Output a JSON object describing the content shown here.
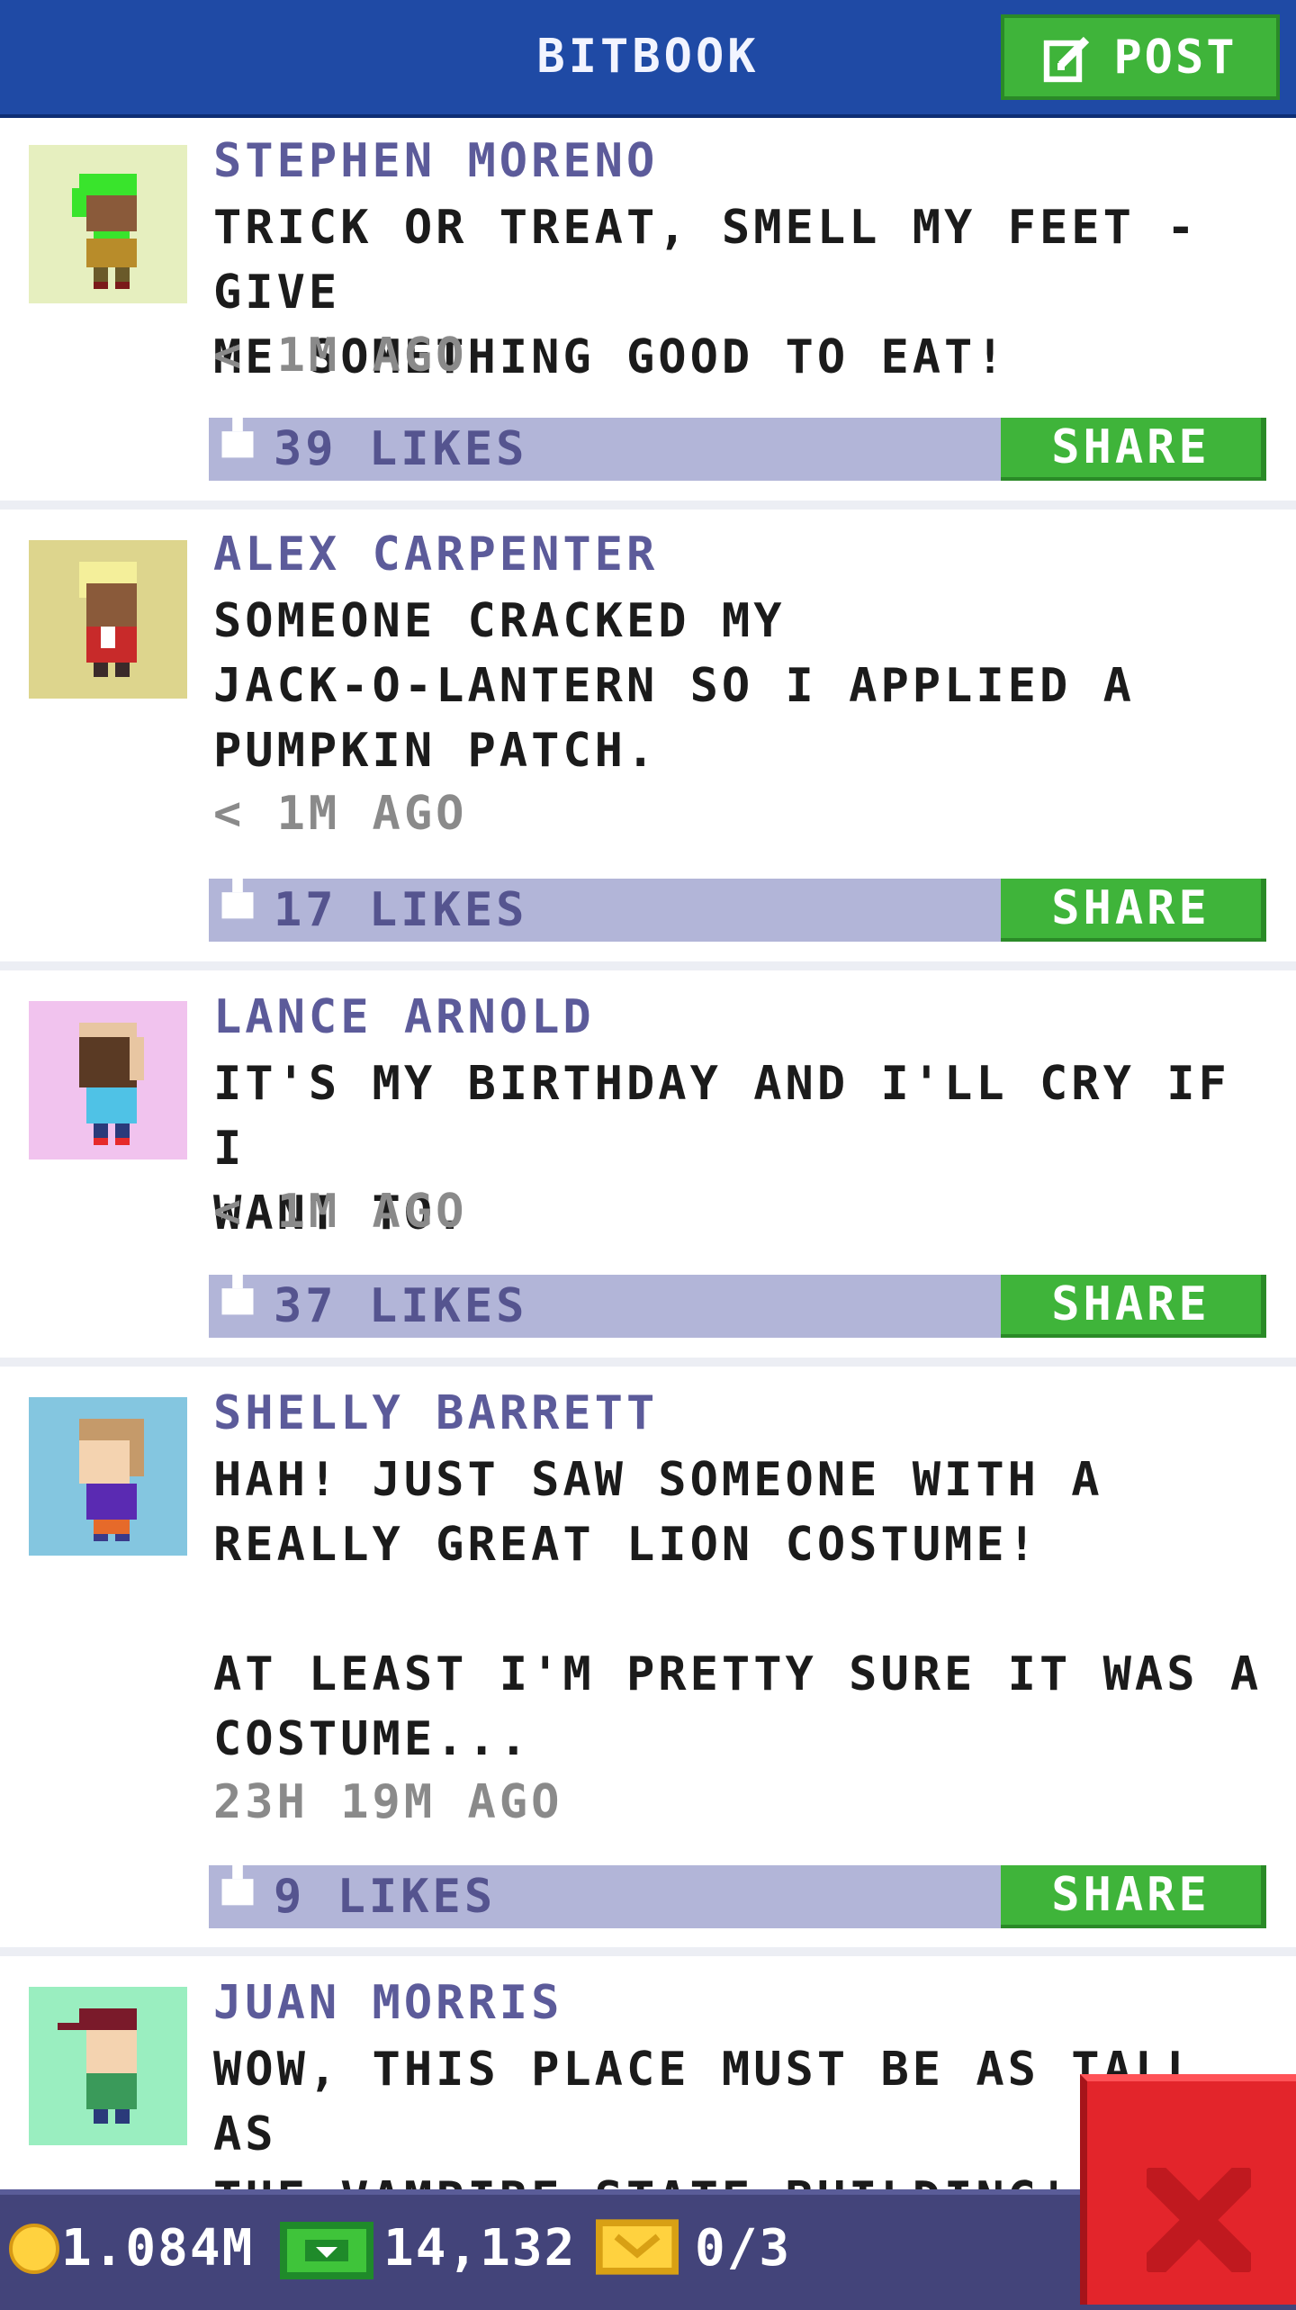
{
  "header": {
    "title": "BITBOOK",
    "post_label": "POST"
  },
  "posts": [
    {
      "author": "STEPHEN MORENO",
      "message": "TRICK OR TREAT, SMELL MY FEET - GIVE\nME SOMETHING GOOD TO EAT!",
      "time": "< 1M AGO",
      "likes": "39 LIKES",
      "share": "SHARE",
      "avatar_bg": "#e6efbf",
      "hair": "#39e42c",
      "skin": "#8a5a3a",
      "shirt": "#b88c2a",
      "pants": "#6a5a2a",
      "avatar_icon": "green-hair-person"
    },
    {
      "author": "ALEX CARPENTER",
      "message": "SOMEONE CRACKED MY\nJACK-O-LANTERN SO I APPLIED A\nPUMPKIN PATCH.",
      "time": "< 1M AGO",
      "likes": "17 LIKES",
      "share": "SHARE",
      "avatar_bg": "#ddd58d",
      "hair": "#f4ef9a",
      "skin": "#8a5a3a",
      "shirt": "#c82a2a",
      "pants": "#3a2a2a",
      "avatar_icon": "blonde-person"
    },
    {
      "author": "LANCE ARNOLD",
      "message": "IT'S MY BIRTHDAY AND I'LL CRY IF I\nWANT TO.",
      "time": "< 1M AGO",
      "likes": "37 LIKES",
      "share": "SHARE",
      "avatar_bg": "#f1c3ee",
      "hair": "#e8c6a2",
      "skin": "#5a3a24",
      "shirt": "#4fc2e6",
      "pants": "#2a3a7a",
      "avatar_icon": "bald-person"
    },
    {
      "author": "SHELLY BARRETT",
      "message": "HAH! JUST SAW SOMEONE WITH A\nREALLY GREAT LION COSTUME!\n\nAT LEAST I'M PRETTY SURE IT WAS A\nCOSTUME...",
      "time": "23H 19M AGO",
      "likes": "9 LIKES",
      "share": "SHARE",
      "avatar_bg": "#84c6e0",
      "hair": "#c59a6a",
      "skin": "#f4d3b0",
      "shirt": "#5a2ab2",
      "pants": "#e66a2a",
      "avatar_icon": "brown-hair-person"
    },
    {
      "author": "JUAN MORRIS",
      "message": "WOW, THIS PLACE MUST BE AS TALL AS\nTHE VAMPIRE STATE BUILDING!",
      "avatar_bg": "#9aeec0",
      "hair": "#7a1a2a",
      "skin": "#f4d3b0",
      "shirt": "#3a9a5a",
      "pants": "#2a3a7a",
      "avatar_icon": "cap-person"
    }
  ],
  "status": {
    "coins": "1.084M",
    "bux": "14,132",
    "tickets": "0/3"
  },
  "colors": {
    "header_blue": "#1f4aa5",
    "share_green": "#3fb43a",
    "likebar": "#b2b5d8",
    "close_red": "#e3252b"
  }
}
